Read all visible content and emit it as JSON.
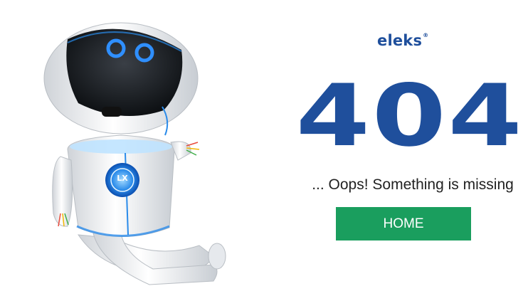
{
  "brand": {
    "name": "eleks",
    "mark": "®"
  },
  "error": {
    "code": "404",
    "message": "... Oops! Something is missing"
  },
  "actions": {
    "home_label": "HOME"
  },
  "robot": {
    "chest_label": "LX"
  },
  "colors": {
    "brand": "#1f4f9c",
    "button": "#1a9e5e",
    "glow": "#1e90ff"
  },
  "icons": [
    "robot-illustration"
  ]
}
